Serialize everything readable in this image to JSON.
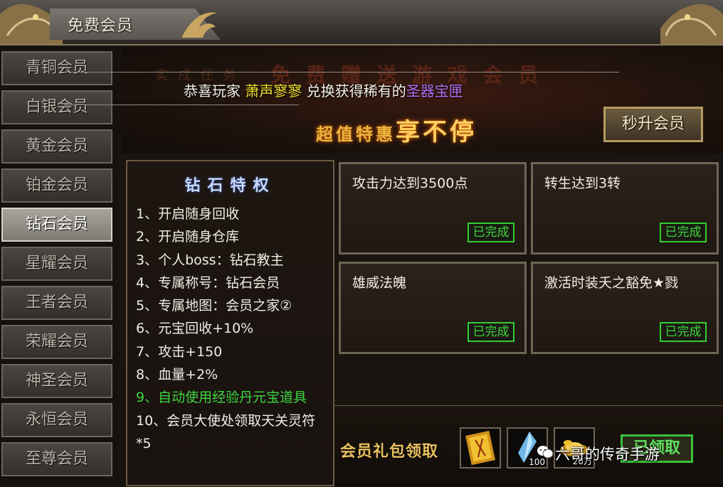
{
  "header": {
    "title": "免费会员"
  },
  "sidebar": {
    "items": [
      {
        "label": "青铜会员"
      },
      {
        "label": "白银会员"
      },
      {
        "label": "黄金会员"
      },
      {
        "label": "铂金会员"
      },
      {
        "label": "钻石会员",
        "active": true
      },
      {
        "label": "星耀会员"
      },
      {
        "label": "王者会员"
      },
      {
        "label": "荣耀会员"
      },
      {
        "label": "神圣会员"
      },
      {
        "label": "永恒会员"
      },
      {
        "label": "至尊会员"
      }
    ]
  },
  "banner": {
    "announce_prefix": "恭喜玩家",
    "player_name": "萧声寥寥",
    "announce_middle": "兑换获得稀有的",
    "item_name": "圣器宝匣",
    "slogan_small": "超值特惠",
    "slogan_big": "享不停",
    "upgrade_button": "秒升会员"
  },
  "privileges": {
    "title": "钻石特权",
    "items": [
      "1、开启随身回收",
      "2、开启随身仓库",
      "3、个人boss：钻石教主",
      "4、专属称号：钻石会员",
      "5、专属地图：会员之家②",
      "6、元宝回收+10%",
      "7、攻击+150",
      "8、血量+2%",
      "9、自动使用经验丹元宝道具",
      "10、会员大使处领取天关灵符*5"
    ]
  },
  "tasks": [
    {
      "title": "攻击力达到3500点",
      "status": "已完成"
    },
    {
      "title": "转生达到3转",
      "status": "已完成"
    },
    {
      "title": "雄威法魄",
      "status": "已完成"
    },
    {
      "title": "激活时装夭之豁免★戮",
      "status": "已完成"
    }
  ],
  "gift": {
    "label": "会员礼包领取",
    "slots": [
      {
        "icon": "talisman-scroll-icon",
        "count": ""
      },
      {
        "icon": "blue-crystal-icon",
        "count": "100"
      },
      {
        "icon": "gold-ingot-icon",
        "count": "20万"
      }
    ],
    "claim_button": "已领取"
  },
  "watermark": {
    "text": "六哥的传奇手游"
  },
  "colors": {
    "accent_gold": "#e8b640",
    "complete_green": "#3fd43f",
    "player_yellow": "#f0e030",
    "item_purple": "#b070f0"
  }
}
